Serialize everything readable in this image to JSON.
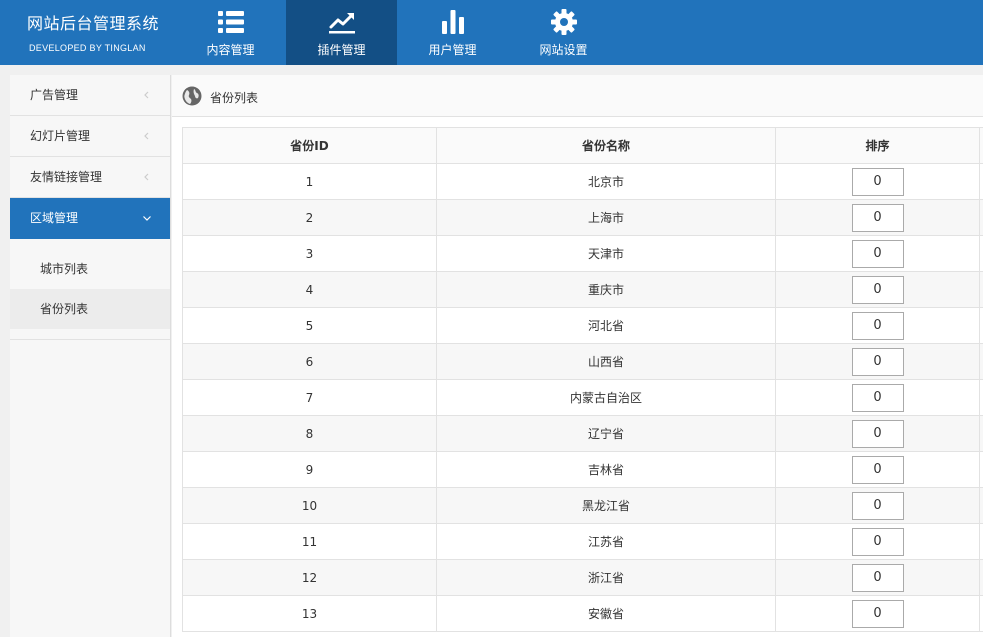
{
  "header": {
    "title": "网站后台管理系统",
    "subtitle": "DEVELOPED BY TINGLAN",
    "nav": [
      {
        "label": "内容管理",
        "icon": "list-icon",
        "active": false
      },
      {
        "label": "插件管理",
        "icon": "trend-chart-icon",
        "active": true
      },
      {
        "label": "用户管理",
        "icon": "bar-chart-icon",
        "active": false
      },
      {
        "label": "网站设置",
        "icon": "gear-icon",
        "active": false
      }
    ]
  },
  "sidebar": {
    "items": [
      {
        "label": "广告管理",
        "icon": "chevron-left-icon"
      },
      {
        "label": "幻灯片管理",
        "icon": "chevron-left-icon"
      },
      {
        "label": "友情链接管理",
        "icon": "chevron-left-icon"
      },
      {
        "label": "区域管理",
        "icon": "chevron-down-icon",
        "active": true
      }
    ],
    "subitems": [
      {
        "label": "城市列表"
      },
      {
        "label": "省份列表",
        "active": true
      }
    ]
  },
  "breadcrumb": {
    "icon": "globe-icon",
    "text": "省份列表"
  },
  "table": {
    "headers": [
      "省份ID",
      "省份名称",
      "排序"
    ],
    "rows": [
      {
        "id": "1",
        "name": "北京市",
        "sort": "0"
      },
      {
        "id": "2",
        "name": "上海市",
        "sort": "0"
      },
      {
        "id": "3",
        "name": "天津市",
        "sort": "0"
      },
      {
        "id": "4",
        "name": "重庆市",
        "sort": "0"
      },
      {
        "id": "5",
        "name": "河北省",
        "sort": "0"
      },
      {
        "id": "6",
        "name": "山西省",
        "sort": "0"
      },
      {
        "id": "7",
        "name": "内蒙古自治区",
        "sort": "0"
      },
      {
        "id": "8",
        "name": "辽宁省",
        "sort": "0"
      },
      {
        "id": "9",
        "name": "吉林省",
        "sort": "0"
      },
      {
        "id": "10",
        "name": "黑龙江省",
        "sort": "0"
      },
      {
        "id": "11",
        "name": "江苏省",
        "sort": "0"
      },
      {
        "id": "12",
        "name": "浙江省",
        "sort": "0"
      },
      {
        "id": "13",
        "name": "安徽省",
        "sort": "0"
      }
    ]
  },
  "colors": {
    "primary": "#2173bb",
    "nav_active": "#134f85"
  }
}
